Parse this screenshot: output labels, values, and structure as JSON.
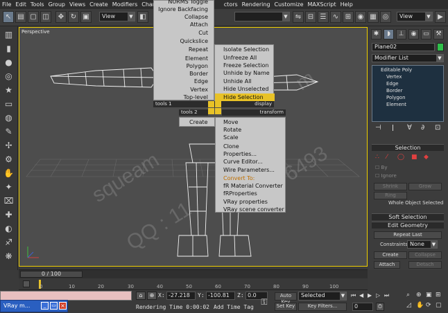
{
  "menubar": {
    "items": [
      "File",
      "Edit",
      "Tools",
      "Group",
      "Views",
      "Create",
      "Modifiers",
      "Character",
      "re",
      "ctors",
      "Rendering",
      "Customize",
      "MAXScript",
      "Help"
    ]
  },
  "toolbar": {
    "view_combo_left": "View",
    "view_combo_right": "View"
  },
  "viewport": {
    "label": "Perspective",
    "watermarks": [
      "squeam",
      "QQ : 11",
      "m",
      "6493"
    ]
  },
  "quad_menu": {
    "top_right": [
      "NURMS Toggle",
      "Ignore Backfacing",
      "Collapse",
      "Attach",
      "Cut",
      "Quickslice",
      "Repeat",
      "Element",
      "Polygon",
      "Border",
      "Edge",
      "Vertex",
      "Top-level"
    ],
    "tools1_label": "tools 1",
    "tools2_label": "tools 2",
    "display_label": "display",
    "transform_label": "transform",
    "display_items": [
      "Isolate Selection",
      "Unfreeze All",
      "Freeze Selection",
      "Unhide by Name",
      "Unhide All",
      "Hide Unselected",
      "Hide Selection"
    ],
    "create_label": "Create",
    "transform_items": [
      "Move",
      "Rotate",
      "Scale",
      "Clone",
      "Properties...",
      "Curve Editor...",
      "Wire Parameters...",
      "Convert To:",
      "fR Material Converter",
      "fRProperties",
      "VRay properties",
      "VRay scene converter"
    ],
    "highlight_color": "#e8c227",
    "convert_color": "#e8a020"
  },
  "command_panel": {
    "object_name": "Plane02",
    "object_color": "#2fc04a",
    "modifier_list": "Modifier List",
    "stack": [
      "Editable Poly",
      "Vertex",
      "Edge",
      "Border",
      "Polygon",
      "Element"
    ],
    "selection_rollout": "Selection",
    "by_label": "By",
    "ignore_label": "Ignore",
    "shrink_label": "Shrink",
    "grow_label": "Grow",
    "ring_label": "Ring",
    "whole_object": "Whole Object Selected",
    "soft_selection": "Soft Selection",
    "edit_geometry": "Edit Geometry",
    "repeat_last": "Repeat Last",
    "constraints_label": "Constraints:",
    "constraints_value": "None",
    "create_btn": "Create",
    "collapse_btn": "Collapse",
    "attach_btn": "Attach",
    "detach_btn": "Detach",
    "slice_plane_btn": "Slice Plane",
    "split_label": "Spli"
  },
  "timeline": {
    "slider_text": "0 / 100",
    "ticks": [
      "0",
      "10",
      "20",
      "30",
      "40",
      "50",
      "60",
      "70",
      "80",
      "90",
      "100"
    ]
  },
  "status": {
    "taskbar_label": "VRay m...",
    "x_label": "X:",
    "x_value": "-27.218",
    "y_label": "Y:",
    "y_value": "-100.81",
    "z_label": "Z:",
    "z_value": "0.0",
    "rendering_time": "Rendering Time  0:00:02",
    "add_time_tag": "Add Time Tag",
    "auto_key": "Auto Key",
    "selected": "Selected",
    "set_key": "Set Key",
    "key_filters": "Key Filters...",
    "frame": "0"
  }
}
